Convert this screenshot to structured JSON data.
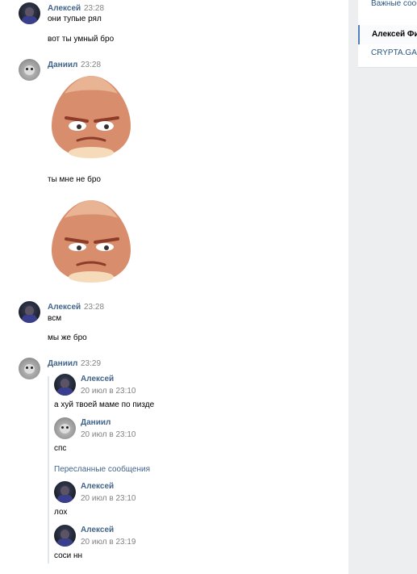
{
  "messages": [
    {
      "author": "Алексей",
      "time": "23:28",
      "lines": [
        "они тупые рял",
        "вот ты умный бро"
      ]
    },
    {
      "author": "Даниил",
      "time": "23:28",
      "lines": [
        "ты мне не бро"
      ]
    },
    {
      "author": "Алексей",
      "time": "23:28",
      "lines": [
        "всм",
        "мы же бро"
      ]
    },
    {
      "author": "Даниил",
      "time": "23:29"
    }
  ],
  "forwarded": {
    "header": "Пересланные сообщения",
    "items": [
      {
        "author": "Алексей",
        "time": "20 июл в 23:10",
        "text": "а хуй твоей маме по пизде"
      },
      {
        "author": "Даниил",
        "time": "20 июл в 23:10",
        "text": "спс"
      },
      {
        "author": "Алексей",
        "time": "20 июл в 23:10",
        "text": "лох"
      },
      {
        "author": "Алексей",
        "time": "20 июл в 23:19",
        "text": "соси нн"
      }
    ]
  },
  "sidebar": {
    "items": [
      {
        "label": "Важные сооб"
      },
      {
        "label": "Алексей Фи"
      },
      {
        "label": "CRYPTA.GAM"
      }
    ]
  },
  "colors": {
    "link": "#42648b",
    "accent": "#5181b8",
    "sticker": "#d88e6c"
  }
}
